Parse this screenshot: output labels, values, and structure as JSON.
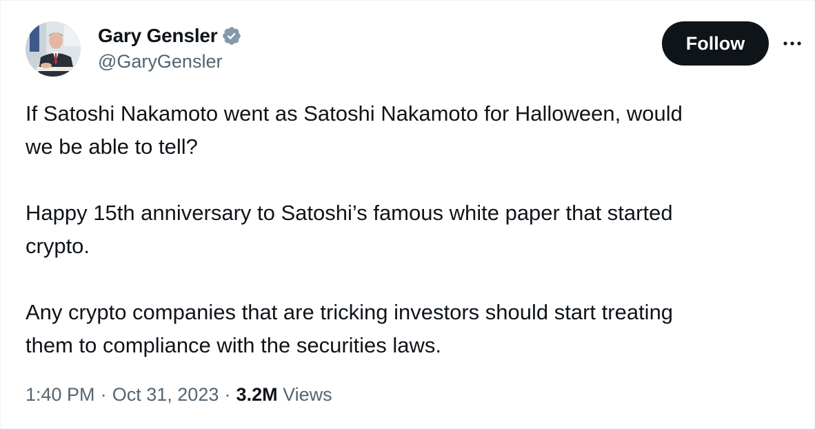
{
  "author": {
    "name": "Gary Gensler",
    "handle": "@GaryGensler",
    "verified": true,
    "verified_badge_color": "#829aab"
  },
  "actions": {
    "follow_label": "Follow",
    "more_icon": "more-horizontal-icon"
  },
  "tweet": {
    "paragraphs": [
      "If Satoshi Nakamoto went as Satoshi Nakamoto for Halloween, would\nwe be able to tell?",
      "Happy 15th anniversary to Satoshi’s famous white paper that started\ncrypto.",
      "Any crypto companies that are tricking investors should start treating\nthem to compliance with the securities laws."
    ]
  },
  "meta": {
    "time": "1:40 PM",
    "separator": "·",
    "date": "Oct 31, 2023",
    "views_count": "3.2M",
    "views_label": "Views"
  },
  "colors": {
    "text_primary": "#0f1419",
    "text_secondary": "#536471",
    "follow_bg": "#0f1419",
    "follow_text": "#ffffff"
  }
}
